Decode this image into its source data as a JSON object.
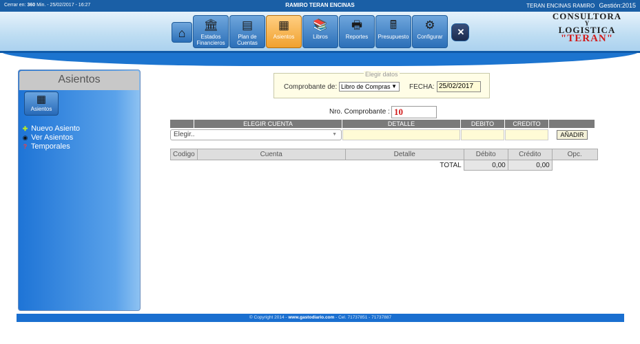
{
  "topbar": {
    "session_prefix": "Cerrar en:",
    "session_minutes": "360",
    "session_suffix": "Min. - 25/02/2017 - 16:27",
    "title": "RAMIRO TERAN ENCINAS",
    "user": "TERAN ENCINAS RAMIRO",
    "gestion": "Gestión:2015"
  },
  "nav": {
    "items": [
      {
        "label": "",
        "icon": "home-icon"
      },
      {
        "label": "Estados Financieros",
        "icon": "bank-icon"
      },
      {
        "label": "Plan de Cuentas",
        "icon": "ledger-icon"
      },
      {
        "label": "Asientos",
        "icon": "calculator-icon",
        "active": true
      },
      {
        "label": "Libros",
        "icon": "books-icon"
      },
      {
        "label": "Reportes",
        "icon": "printer-icon"
      },
      {
        "label": "Presupuesto",
        "icon": "calculator-pen-icon"
      },
      {
        "label": "Configurar",
        "icon": "tools-icon"
      },
      {
        "label": "",
        "icon": "close-icon"
      }
    ],
    "estados_l1": "Estados",
    "estados_l2": "Financieros",
    "plan_l1": "Plan de",
    "plan_l2": "Cuentas",
    "asientos": "Asientos",
    "libros": "Libros",
    "reportes": "Reportes",
    "presupuesto": "Presupuesto",
    "configurar": "Configurar"
  },
  "logo": {
    "line1": "CONSULTORA",
    "line2": "Y",
    "line3": "LOGISTICA",
    "line4": "\"TERAN\""
  },
  "sidebar": {
    "title": "Asientos",
    "button_label": "Asientos",
    "menu": [
      {
        "label": "Nuevo Asiento",
        "icon": "plus-icon"
      },
      {
        "label": "Ver Asientos",
        "icon": "eye-icon"
      },
      {
        "label": "Temporales",
        "icon": "question-icon"
      }
    ]
  },
  "form": {
    "legend": "Elegir datos",
    "comprobante_label": "Comprobante de:",
    "comprobante_value": "Libro de Compras",
    "fecha_label": "FECHA:",
    "fecha_value": "25/02/2017",
    "nro_label": "Nro. Comprobante :",
    "nro_value": "10"
  },
  "entry": {
    "headers": {
      "cuenta": "ELEGIR CUENTA",
      "detalle": "DETALLE",
      "debito": "DEBITO",
      "credito": "CREDITO"
    },
    "cuenta_placeholder": "Elegir..",
    "add_button": "AÑADIR"
  },
  "table": {
    "columns": [
      "Codigo",
      "Cuenta",
      "Detalle",
      "Débito",
      "Crédito",
      "Opc."
    ],
    "total_label": "TOTAL",
    "total_debito": "0,00",
    "total_credito": "0,00"
  },
  "footer": {
    "prefix": "© Copyright 2014 -",
    "site": "www.gastodiario.com",
    "suffix": "- Cel. 71737851 - 71737887"
  }
}
